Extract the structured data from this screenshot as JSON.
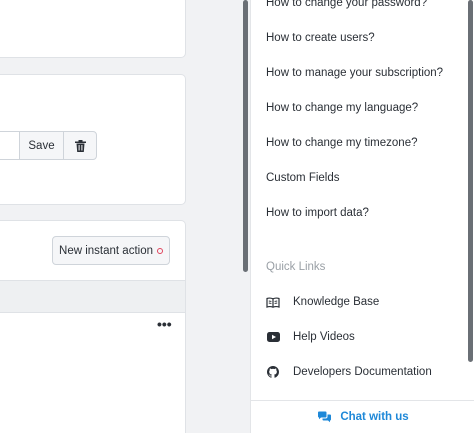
{
  "main": {
    "save_label": "Save",
    "new_instant_action_label": "New instant action",
    "more_label": "•••"
  },
  "help_panel": {
    "links": [
      "How to change your password?",
      "How to create users?",
      "How to manage your subscription?",
      "How to change my language?",
      "How to change my timezone?",
      "Custom Fields",
      "How to import data?"
    ],
    "quick_links_title": "Quick Links",
    "quick_links": [
      {
        "label": "Knowledge Base",
        "icon": "book-icon"
      },
      {
        "label": "Help Videos",
        "icon": "youtube-icon"
      },
      {
        "label": "Developers Documentation",
        "icon": "github-icon"
      }
    ],
    "chat_label": "Chat with us",
    "accent_color": "#1e88d8"
  }
}
